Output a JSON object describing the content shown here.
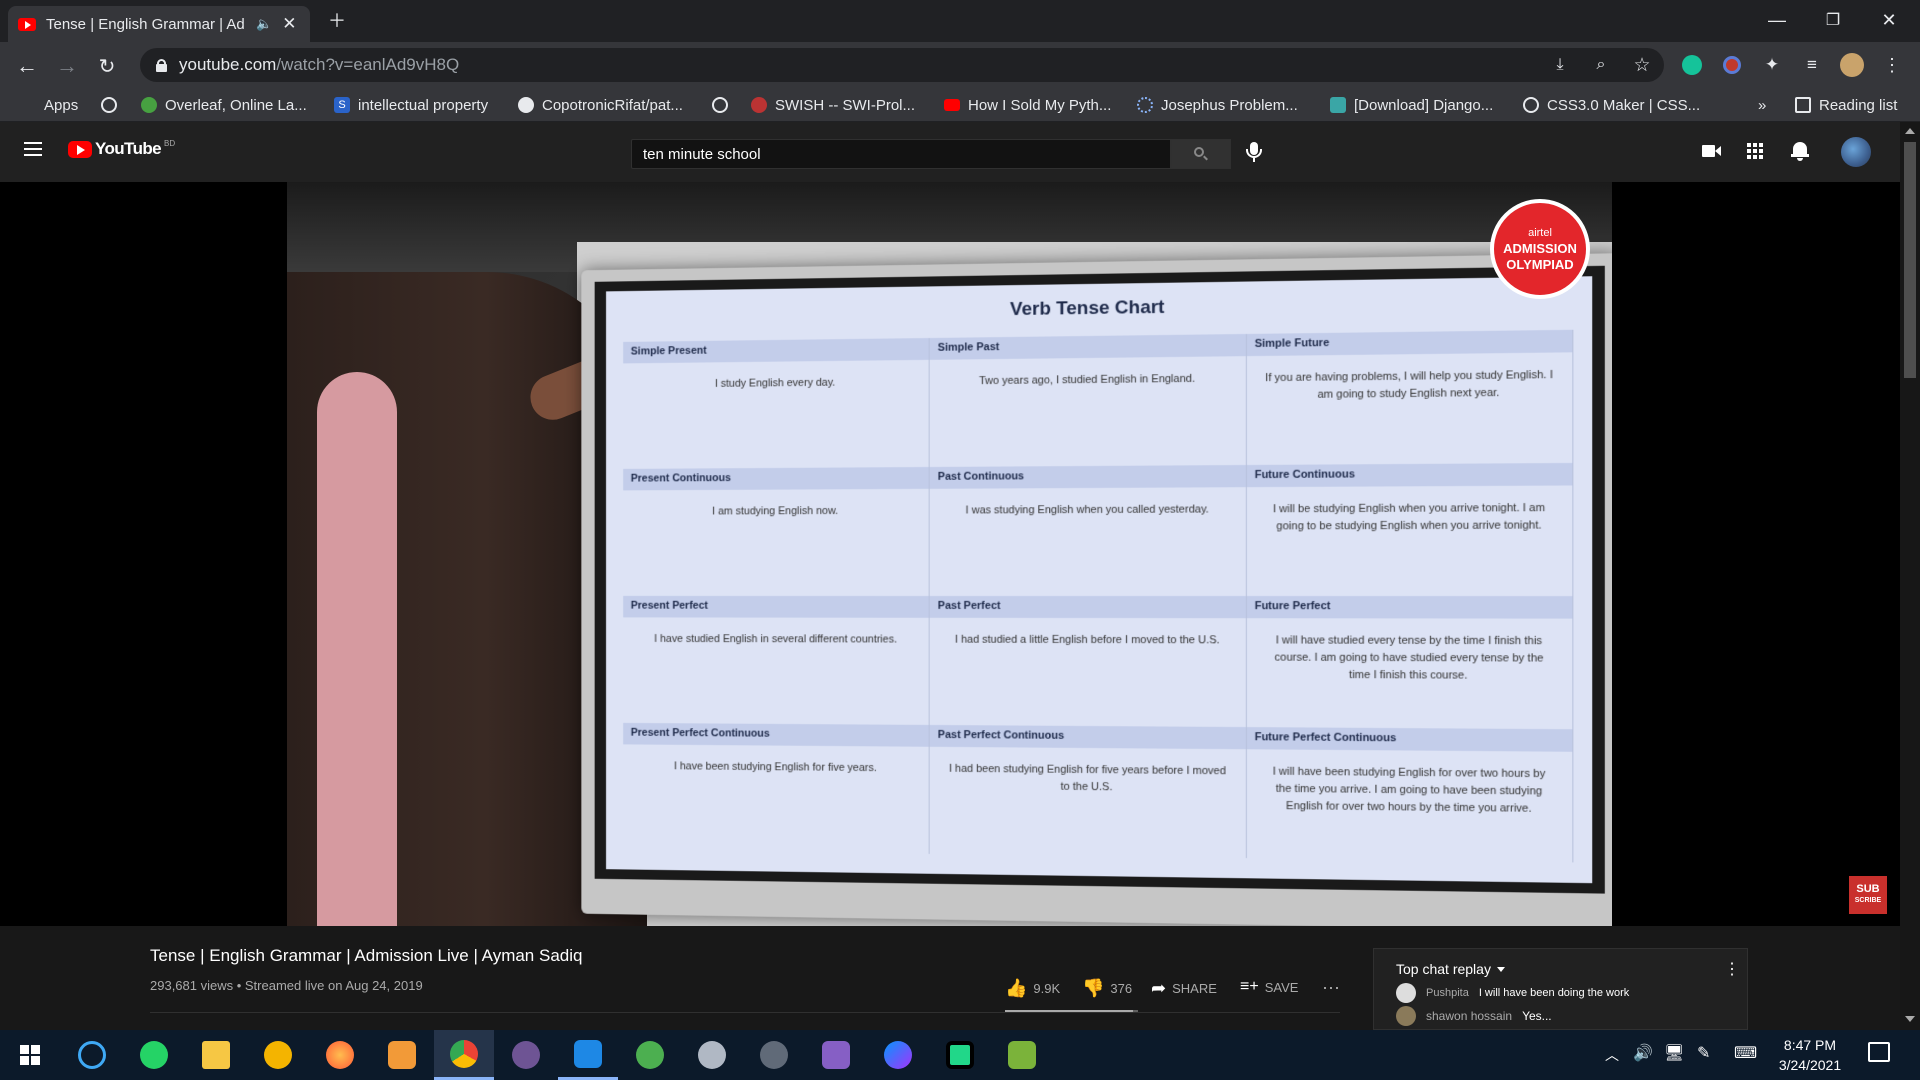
{
  "browser": {
    "tab_title": "Tense | English Grammar | Ad",
    "url_host": "youtube.com",
    "url_path": "/watch?v=eanlAd9vH8Q",
    "bookmarks": [
      {
        "label": "Apps"
      },
      {
        "label": ""
      },
      {
        "label": "Overleaf, Online La..."
      },
      {
        "label": "intellectual property"
      },
      {
        "label": "CopotronicRifat/pat..."
      },
      {
        "label": ""
      },
      {
        "label": "SWISH -- SWI-Prol..."
      },
      {
        "label": "How I Sold My Pyth..."
      },
      {
        "label": "Josephus Problem..."
      },
      {
        "label": "[Download] Django..."
      },
      {
        "label": "CSS3.0 Maker | CSS..."
      }
    ],
    "more_bookmarks": "»",
    "reading_list": "Reading list"
  },
  "youtube": {
    "logo_text": "YouTube",
    "logo_region": "BD",
    "search_value": "ten minute school"
  },
  "video": {
    "chart_title": "Verb Tense Chart",
    "badge_line1": "airtel",
    "badge_line2": "ADMISSION",
    "badge_line3": "OLYMPIAD",
    "subscribe_l1": "SUB",
    "subscribe_l2": "SCRIBE",
    "rows": [
      {
        "cells": [
          {
            "head": "Simple Present",
            "text": "I study English every day."
          },
          {
            "head": "Simple Past",
            "text": "Two years ago, I studied English in England."
          },
          {
            "head": "Simple Future",
            "text": "If you are having problems, I will help you study English. I am going to study English next year."
          }
        ]
      },
      {
        "cells": [
          {
            "head": "Present Continuous",
            "text": "I am studying English now."
          },
          {
            "head": "Past Continuous",
            "text": "I was studying English when you called yesterday."
          },
          {
            "head": "Future Continuous",
            "text": "I will be studying English when you arrive tonight. I am going to be studying English when you arrive tonight."
          }
        ]
      },
      {
        "cells": [
          {
            "head": "Present Perfect",
            "text": "I have studied English in several different countries."
          },
          {
            "head": "Past Perfect",
            "text": "I had studied a little English before I moved to the U.S."
          },
          {
            "head": "Future Perfect",
            "text": "I will have studied every tense by the time I finish this course. I am going to have studied every tense by the time I finish this course."
          }
        ]
      },
      {
        "cells": [
          {
            "head": "Present Perfect Continuous",
            "text": "I have been studying English for five years."
          },
          {
            "head": "Past Perfect Continuous",
            "text": "I had been studying English for five years before I moved to the U.S."
          },
          {
            "head": "Future Perfect Continuous",
            "text": "I will have been studying English for over two hours by the time you arrive. I am going to have been studying English for over two hours by the time you arrive."
          }
        ]
      }
    ]
  },
  "info": {
    "title": "Tense | English Grammar | Admission Live | Ayman Sadiq",
    "meta": "293,681 views • Streamed live on Aug 24, 2019",
    "likes": "9.9K",
    "dislikes": "376",
    "like_fraction": 0.96,
    "share": "SHARE",
    "save": "SAVE"
  },
  "chat": {
    "header": "Top chat replay",
    "messages": [
      {
        "author": "Pushpita",
        "text": "I will have been doing the work"
      },
      {
        "author": "shawon hossain",
        "text": "Yes..."
      }
    ]
  },
  "taskbar": {
    "time": "8:47 PM",
    "date": "3/24/2021"
  },
  "colors": {
    "youtube_red": "#ff0000",
    "chrome_bg": "#202124",
    "toolbar_bg": "#35363a",
    "yt_dark": "#212121"
  }
}
